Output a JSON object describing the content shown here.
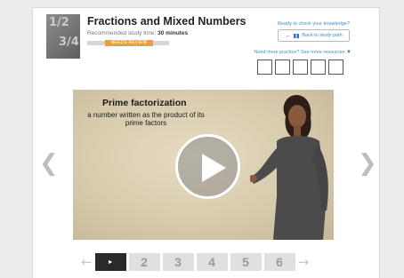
{
  "lesson": {
    "title": "Fractions and Mixed Numbers",
    "study_time_label": "Recommended study time:",
    "study_time_value": "30 minutes",
    "status_badge": "NEEDS REVIEW",
    "thumbnail_text": [
      "1/2",
      "3/4"
    ]
  },
  "actions": {
    "ready_link": "Ready to check your knowledge?",
    "back_button": "Back to study path",
    "more_resources_link": "Need more practice? See more resources"
  },
  "resources": {
    "count": 5
  },
  "video": {
    "slide_title": "Prime factorization",
    "slide_text": "a number written as the product of its prime factors"
  },
  "icons": {
    "back": "arrow-left-icon",
    "bars": "bars-icon",
    "caret": "caret-down-icon",
    "play": "play-icon",
    "prev": "chevron-left-icon",
    "next": "chevron-right-icon"
  },
  "segments": {
    "active_glyph": "►",
    "items": [
      "2",
      "3",
      "4",
      "5",
      "6"
    ]
  },
  "colors": {
    "accent": "#3f8fc9",
    "badge": "#e8a13a",
    "active_segment": "#2a2a2a"
  }
}
